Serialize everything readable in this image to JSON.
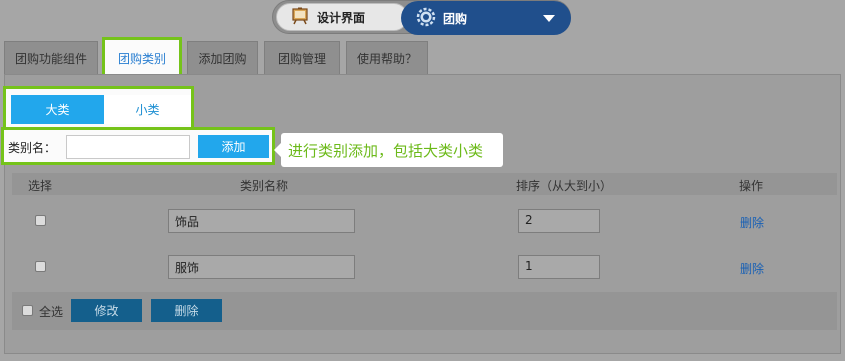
{
  "switcher": {
    "left_label": "设计界面",
    "right_label": "团购",
    "left_icon": "design-board-icon",
    "right_icon": "gear-icon",
    "accent": "#204f8c"
  },
  "tabs": [
    {
      "label": "团购功能组件"
    },
    {
      "label": "团购类别",
      "active": true
    },
    {
      "label": "添加团购"
    },
    {
      "label": "团购管理"
    },
    {
      "label": "使用帮助？"
    }
  ],
  "category_toggle": {
    "big": "大类",
    "small": "小类"
  },
  "add_form": {
    "label": "类别名：",
    "value": "",
    "placeholder": "",
    "button": "添加"
  },
  "callout": "进行类别添加，包括大类小类",
  "table": {
    "headers": [
      "选择",
      "类别名称",
      "排序（从大到小）",
      "操作"
    ],
    "rows": [
      {
        "name": "饰品",
        "order": "2",
        "action": "删除"
      },
      {
        "name": "服饰",
        "order": "1",
        "action": "删除"
      }
    ]
  },
  "footer": {
    "select_all": "全选",
    "modify_button": "修改",
    "delete_button": "删除"
  },
  "colors": {
    "highlight": "#75c31a",
    "primary_button": "#22a7ec"
  }
}
